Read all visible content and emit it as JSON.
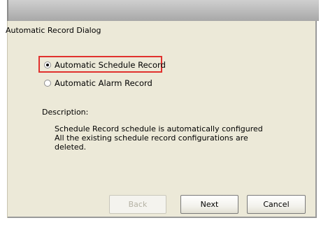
{
  "dialog": {
    "title": "Automatic Record Dialog"
  },
  "options": [
    {
      "label": "Automatic Schedule Record",
      "selected": true
    },
    {
      "label": "Automatic Alarm Record",
      "selected": false
    }
  ],
  "description": {
    "label": "Description:",
    "lines": [
      "Schedule Record schedule is automatically configured",
      "All the existing schedule record configurations are",
      "deleted."
    ]
  },
  "buttons": {
    "back": "Back",
    "next": "Next",
    "cancel": "Cancel"
  },
  "colors": {
    "dialog_bg": "#ece9d8",
    "highlight": "#e1312e"
  }
}
